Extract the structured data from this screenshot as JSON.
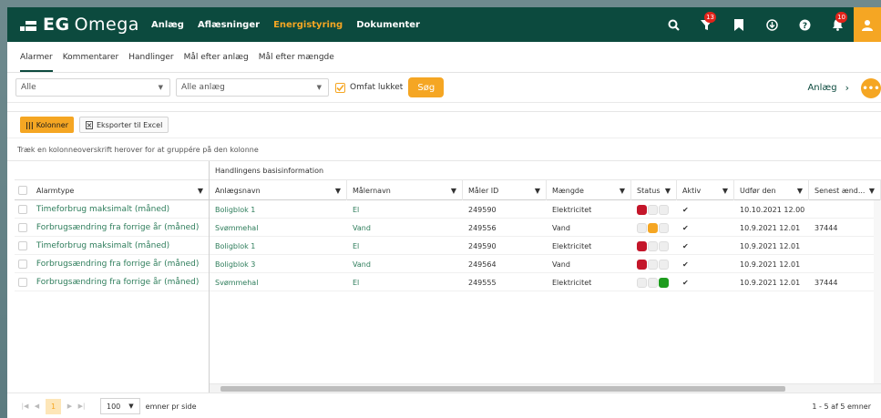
{
  "colors": {
    "nav_bg": "#0c4a3e",
    "accent": "#f5a623",
    "link": "#2e7d5b",
    "danger": "#c4162a",
    "ok": "#1e9c1e"
  },
  "logo": {
    "brand": "EG",
    "product": "Omega"
  },
  "nav": {
    "items": [
      "Anlæg",
      "Aflæsninger",
      "Energistyring",
      "Dokumenter"
    ],
    "active": "Energistyring"
  },
  "top_icons": {
    "search": "search-icon",
    "filter": "filter-icon",
    "filter_badge": "13",
    "bookmark": "bookmark-icon",
    "download": "download-icon",
    "help": "help-icon",
    "bell": "bell-icon",
    "bell_badge": "10",
    "user": "user-icon"
  },
  "tabs": [
    "Alarmer",
    "Kommentarer",
    "Handlinger",
    "Mål efter anlæg",
    "Mål efter mængde"
  ],
  "filters": {
    "select1": "Alle",
    "select2": "Alle anlæg",
    "checkbox_label": "Omfat lukket",
    "search_button": "Søg",
    "anlaeg_link": "Anlæg"
  },
  "toolbar": {
    "columns_button": "Kolonner",
    "export_button": "Eksporter til Excel"
  },
  "group_hint": "Træk en kolonneoverskrift herover for at gruppére på den kolonne",
  "grid": {
    "group_header": "Handlingens basisinformation",
    "locked_header": "Alarmtype",
    "headers": [
      "Anlægsnavn",
      "Målernavn",
      "Måler ID",
      "Mængde",
      "Status",
      "Aktiv",
      "Udfør den",
      "Senest ænd..."
    ],
    "rows": [
      {
        "alarmtype": "Timeforbrug maksimalt (måned)",
        "anlaeg": "Boligblok 1",
        "maaler": "El",
        "maaler_id": "249590",
        "maengde": "Elektricitet",
        "status": "red",
        "aktiv": "✔",
        "udfoer": "10.10.2021 12.00",
        "senest": ""
      },
      {
        "alarmtype": "Forbrugsændring fra forrige år (måned)",
        "anlaeg": "Svømmehal",
        "maaler": "Vand",
        "maaler_id": "249556",
        "maengde": "Vand",
        "status": "orange",
        "aktiv": "✔",
        "udfoer": "10.9.2021 12.01",
        "senest": "37444"
      },
      {
        "alarmtype": "Timeforbrug maksimalt (måned)",
        "anlaeg": "Boligblok 1",
        "maaler": "El",
        "maaler_id": "249590",
        "maengde": "Elektricitet",
        "status": "red",
        "aktiv": "✔",
        "udfoer": "10.9.2021 12.01",
        "senest": ""
      },
      {
        "alarmtype": "Forbrugsændring fra forrige år (måned)",
        "anlaeg": "Boligblok 3",
        "maaler": "Vand",
        "maaler_id": "249564",
        "maengde": "Vand",
        "status": "red",
        "aktiv": "✔",
        "udfoer": "10.9.2021 12.01",
        "senest": ""
      },
      {
        "alarmtype": "Forbrugsændring fra forrige år (måned)",
        "anlaeg": "Svømmehal",
        "maaler": "El",
        "maaler_id": "249555",
        "maengde": "Elektricitet",
        "status": "green",
        "aktiv": "✔",
        "udfoer": "10.9.2021 12.01",
        "senest": "37444"
      }
    ]
  },
  "pager": {
    "current": "1",
    "page_size": "100",
    "page_size_label": "emner pr side",
    "info": "1 - 5 af 5 emner"
  }
}
